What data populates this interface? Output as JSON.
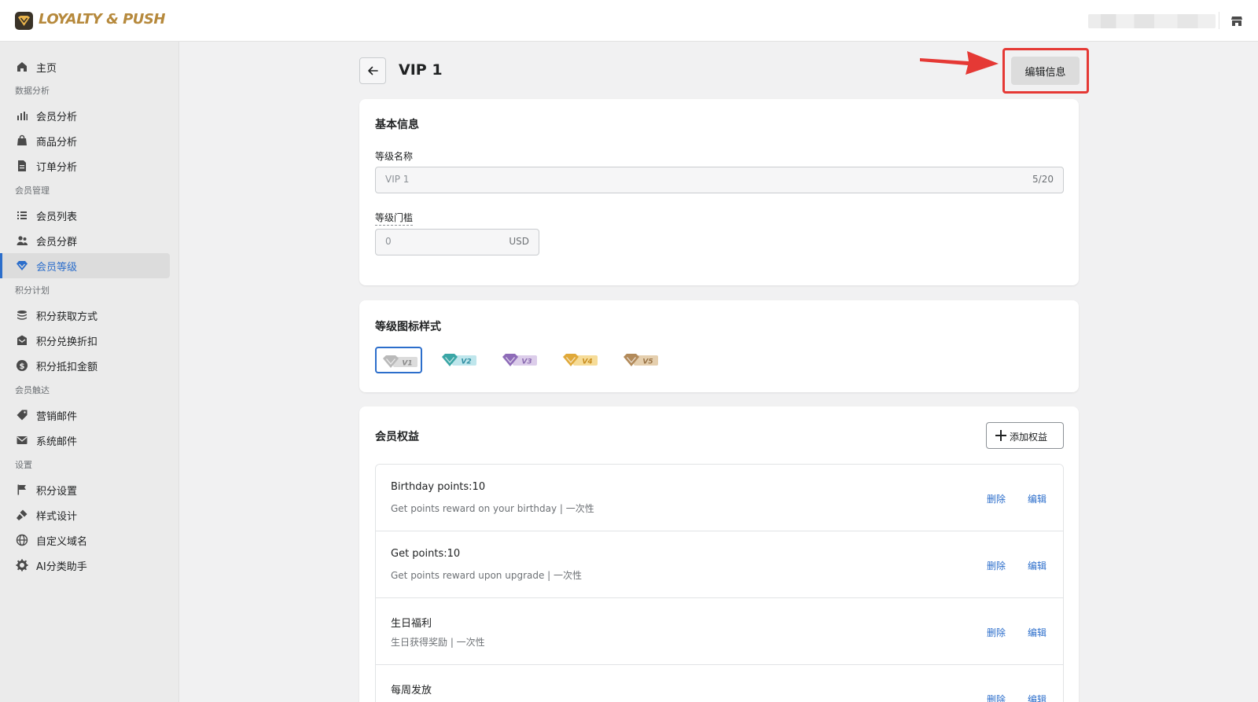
{
  "app": {
    "brand": "LOYALTY & PUSH"
  },
  "sidebar": {
    "home": "主页",
    "sections": {
      "analytics": "数据分析",
      "members": "会员管理",
      "points": "积分计划",
      "reach": "会员触达",
      "settings": "设置"
    },
    "items": {
      "member_analytics": "会员分析",
      "product_analytics": "商品分析",
      "order_analytics": "订单分析",
      "member_list": "会员列表",
      "member_groups": "会员分群",
      "member_tiers": "会员等级",
      "points_earning": "积分获取方式",
      "points_redeem": "积分兑换折扣",
      "points_cash": "积分抵扣金额",
      "marketing_email": "营销邮件",
      "system_email": "系统邮件",
      "points_settings": "积分设置",
      "style_design": "样式设计",
      "custom_domain": "自定义域名",
      "ai_assistant": "AI分类助手"
    },
    "active": "member_tiers"
  },
  "header": {
    "title": "VIP 1",
    "edit_button": "编辑信息"
  },
  "basic_info": {
    "title": "基本信息",
    "name_label": "等级名称",
    "name_value": "VIP 1",
    "name_counter": "5/20",
    "threshold_label": "等级门槛",
    "threshold_value": "0",
    "threshold_unit": "USD"
  },
  "icon_style": {
    "title": "等级图标样式",
    "tiers": [
      {
        "label": "V1",
        "color": "#b9b9b9",
        "tag_color": "#dcdcdc",
        "text_color": "#8a8a8a"
      },
      {
        "label": "V2",
        "color": "#3aa6a6",
        "tag_color": "#bfe6ec",
        "text_color": "#2f8fa3"
      },
      {
        "label": "V3",
        "color": "#8e6bb8",
        "tag_color": "#dccdea",
        "text_color": "#8a6bb0"
      },
      {
        "label": "V4",
        "color": "#e0a93a",
        "tag_color": "#f6dc98",
        "text_color": "#c98d1f"
      },
      {
        "label": "V5",
        "color": "#b28a5a",
        "tag_color": "#e5cfae",
        "text_color": "#9a7447"
      }
    ],
    "selected": 0
  },
  "benefits": {
    "title": "会员权益",
    "add_button": "添加权益",
    "delete_label": "删除",
    "edit_label": "编辑",
    "items": [
      {
        "title": "Birthday points:10",
        "desc": "Get points reward on your birthday | 一次性"
      },
      {
        "title": "Get points:10",
        "desc": "Get points reward upon upgrade | 一次性"
      },
      {
        "title": "生日福利",
        "desc": "生日获得奖励 | 一次性"
      },
      {
        "title": "每周发放",
        "desc": ""
      }
    ]
  },
  "colors": {
    "accent": "#2c6ecb",
    "annotation": "#e53935",
    "brand": "#b6893c"
  }
}
